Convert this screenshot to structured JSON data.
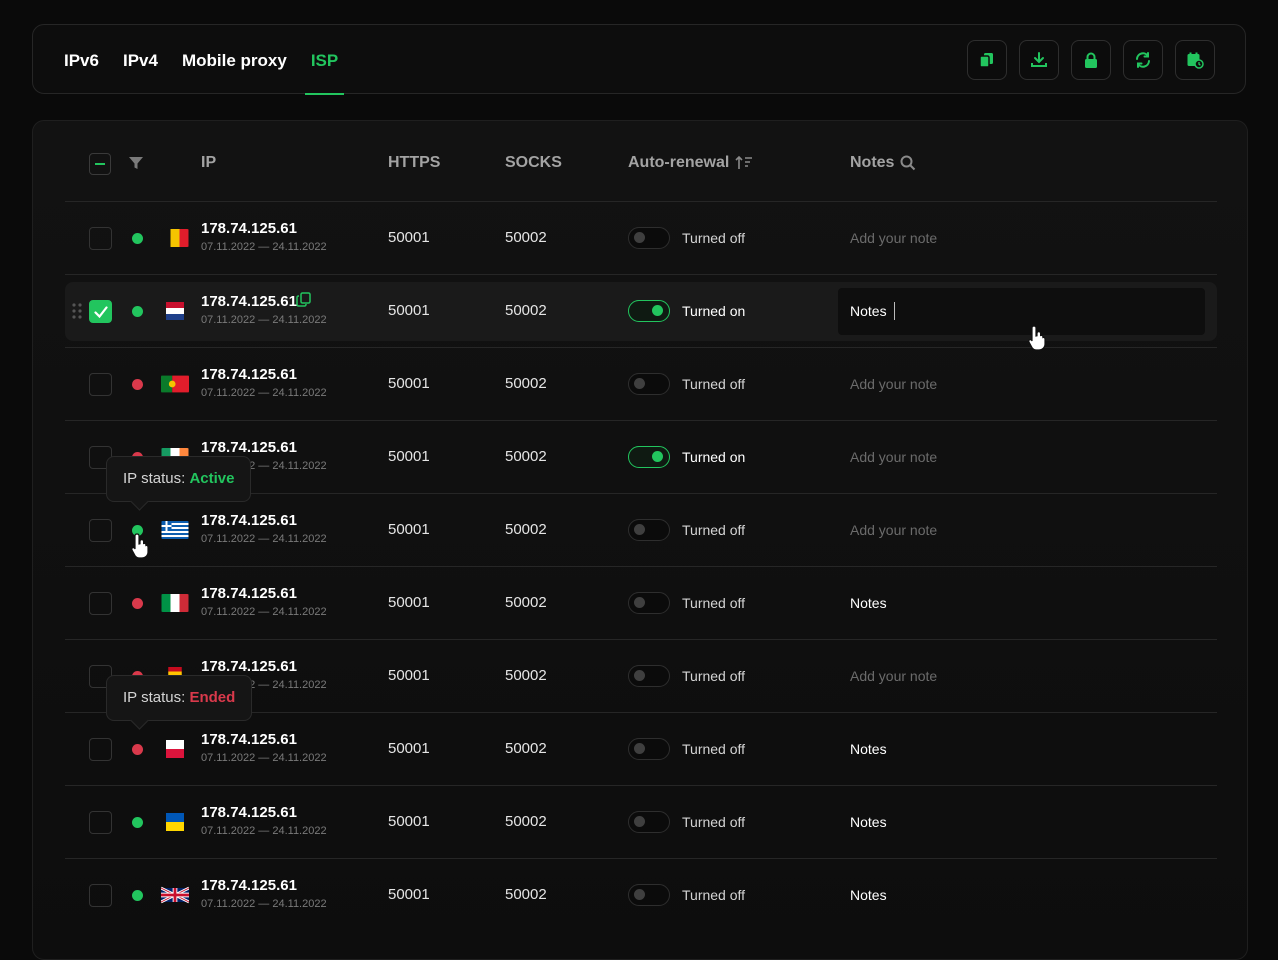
{
  "tabs": [
    {
      "label": "IPv6",
      "active": false
    },
    {
      "label": "IPv4",
      "active": false
    },
    {
      "label": "Mobile proxy",
      "active": false
    },
    {
      "label": "ISP",
      "active": true
    }
  ],
  "toolbar": [
    {
      "icon": "copy-icon"
    },
    {
      "icon": "download-icon"
    },
    {
      "icon": "lock-icon"
    },
    {
      "icon": "refresh-icon"
    },
    {
      "icon": "calendar-clock-icon"
    }
  ],
  "columns": {
    "ip": "IP",
    "https": "HTTPS",
    "socks": "SOCKS",
    "auto_renewal": "Auto-renewal",
    "notes": "Notes"
  },
  "colors": {
    "accent": "#22c55e",
    "danger": "#d9394b"
  },
  "rows": [
    {
      "ip": "178.74.125.61",
      "dates": "07.11.2022 — 24.11.2022",
      "https": "50001",
      "socks": "50002",
      "status": "green",
      "flag": "belgium",
      "auto_on": false,
      "auto_label": "Turned off",
      "note": "Add your note",
      "note_filled": false
    },
    {
      "ip": "178.74.125.61",
      "dates": "07.11.2022 — 24.11.2022",
      "https": "50001",
      "socks": "50002",
      "status": "green",
      "flag": "netherlands",
      "auto_on": true,
      "auto_label": "Turned on",
      "note": "Notes",
      "note_filled": true,
      "selected": true
    },
    {
      "ip": "178.74.125.61",
      "dates": "07.11.2022 — 24.11.2022",
      "https": "50001",
      "socks": "50002",
      "status": "red",
      "flag": "portugal",
      "auto_on": false,
      "auto_label": "Turned off",
      "note": "Add your note",
      "note_filled": false
    },
    {
      "ip": "178.74.125.61",
      "dates": "07.11.2022 — 24.11.2022",
      "https": "50001",
      "socks": "50002",
      "status": "red",
      "flag": "ireland",
      "auto_on": true,
      "auto_label": "Turned on",
      "note": "Add your note",
      "note_filled": false
    },
    {
      "ip": "178.74.125.61",
      "dates": "07.11.2022 — 24.11.2022",
      "https": "50001",
      "socks": "50002",
      "status": "green",
      "flag": "greece",
      "auto_on": false,
      "auto_label": "Turned off",
      "note": "Add your note",
      "note_filled": false
    },
    {
      "ip": "178.74.125.61",
      "dates": "07.11.2022 — 24.11.2022",
      "https": "50001",
      "socks": "50002",
      "status": "red",
      "flag": "italy",
      "auto_on": false,
      "auto_label": "Turned off",
      "note": "Notes",
      "note_filled": true
    },
    {
      "ip": "178.74.125.61",
      "dates": "07.11.2022 — 24.11.2022",
      "https": "50001",
      "socks": "50002",
      "status": "red",
      "flag": "spain",
      "auto_on": false,
      "auto_label": "Turned off",
      "note": "Add your note",
      "note_filled": false
    },
    {
      "ip": "178.74.125.61",
      "dates": "07.11.2022 — 24.11.2022",
      "https": "50001",
      "socks": "50002",
      "status": "red",
      "flag": "poland",
      "auto_on": false,
      "auto_label": "Turned off",
      "note": "Notes",
      "note_filled": true
    },
    {
      "ip": "178.74.125.61",
      "dates": "07.11.2022 — 24.11.2022",
      "https": "50001",
      "socks": "50002",
      "status": "green",
      "flag": "ukraine",
      "auto_on": false,
      "auto_label": "Turned off",
      "note": "Notes",
      "note_filled": true
    },
    {
      "ip": "178.74.125.61",
      "dates": "07.11.2022 — 24.11.2022",
      "https": "50001",
      "socks": "50002",
      "status": "green",
      "flag": "united-kingdom",
      "auto_on": false,
      "auto_label": "Turned off",
      "note": "Notes",
      "note_filled": true
    }
  ],
  "tooltips": [
    {
      "label": "IP status:",
      "value": "Active",
      "tone": "green"
    },
    {
      "label": "IP status:",
      "value": "Ended",
      "tone": "red"
    }
  ]
}
